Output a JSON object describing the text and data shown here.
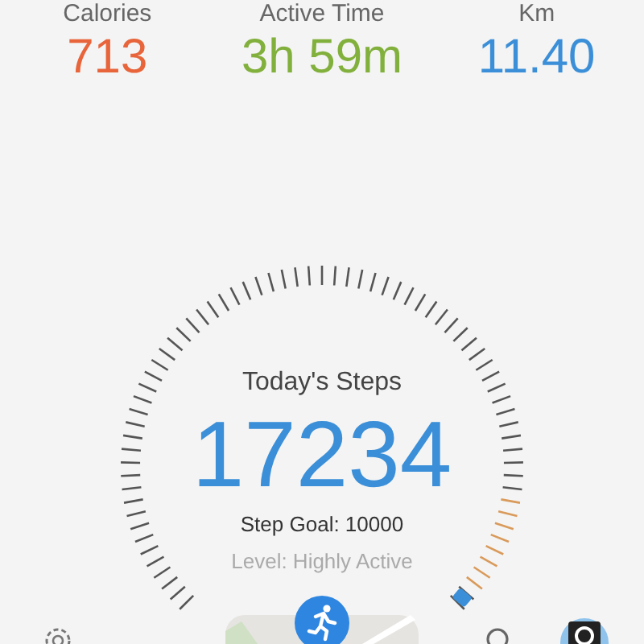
{
  "stats": [
    {
      "label": "Calories",
      "value": "713",
      "color": "#e8643a"
    },
    {
      "label": "Active Time",
      "value": "3h 59m",
      "color": "#82b03c"
    },
    {
      "label": "Km",
      "value": "11.40",
      "color": "#3b8fd8"
    }
  ],
  "steps": {
    "title": "Today's Steps",
    "count": "17234",
    "goal": "Step Goal: 10000",
    "level_text": "Level: Highly Active"
  }
}
